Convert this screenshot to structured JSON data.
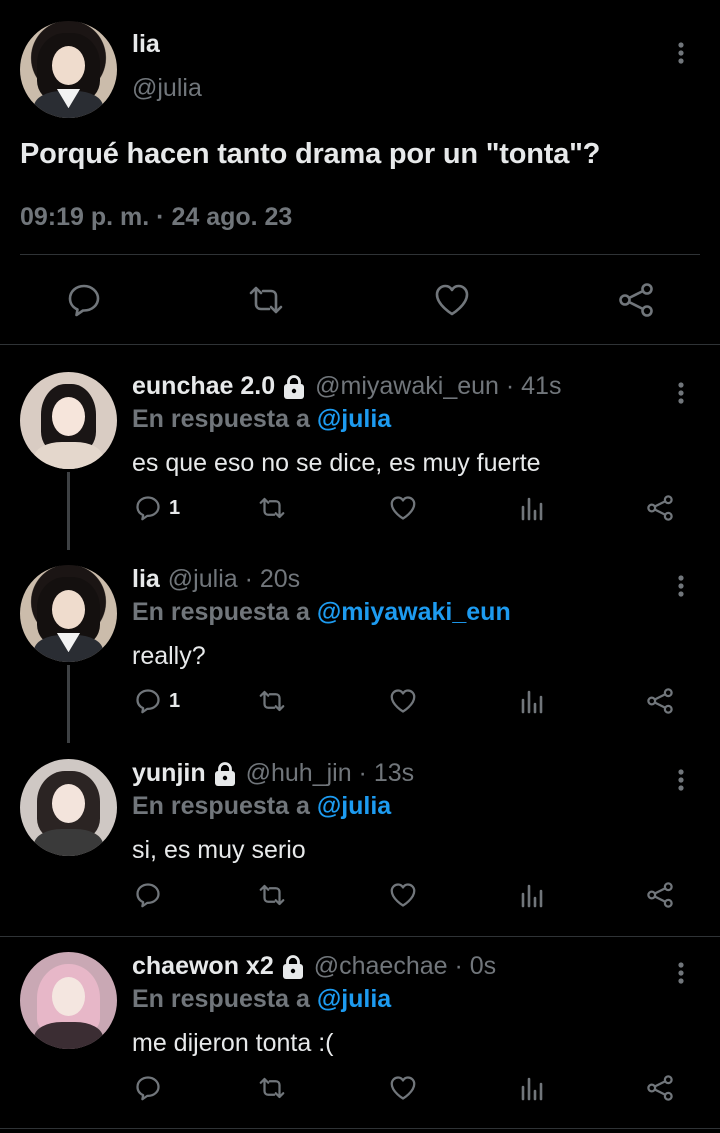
{
  "main_tweet": {
    "name": "lia",
    "handle": "@julia",
    "text": "Porqué hacen tanto drama por un \"tonta\"?",
    "timestamp": "09:19 p. m. · 24 ago. 23",
    "icons": [
      "reply-icon",
      "retweet-icon",
      "like-icon",
      "share-icon"
    ]
  },
  "replies": [
    {
      "name": "eunchae 2.0",
      "locked": true,
      "handle": "@miyawaki_eun · 41s",
      "replying_prefix": "En respuesta a",
      "replying_to": "@julia",
      "text": "es que eso no se dice, es muy fuerte",
      "reply_count": "1"
    },
    {
      "name": "lia",
      "locked": false,
      "handle": "@julia · 20s",
      "replying_prefix": "En respuesta a",
      "replying_to": "@miyawaki_eun",
      "text": "really?",
      "reply_count": "1"
    },
    {
      "name": "yunjin",
      "locked": true,
      "handle": "@huh_jin · 13s",
      "replying_prefix": "En respuesta a",
      "replying_to": "@julia",
      "text": "si, es muy serio",
      "reply_count": ""
    },
    {
      "name": "chaewon x2",
      "locked": true,
      "handle": "@chaechae · 0s",
      "replying_prefix": "En respuesta a",
      "replying_to": "@julia",
      "text": "me dijeron tonta :(",
      "reply_count": ""
    }
  ],
  "colors": {
    "background": "#000000",
    "text": "#e7e9ea",
    "secondary": "#71767b",
    "mention": "#1d9bf0",
    "divider": "#2f3336"
  }
}
